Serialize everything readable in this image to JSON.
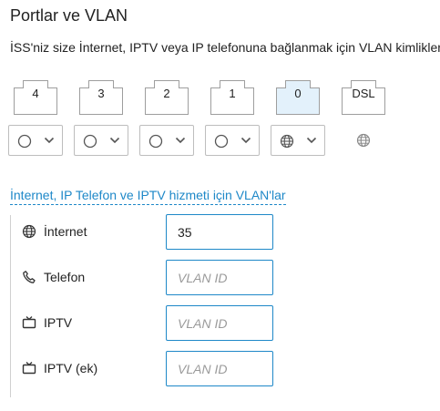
{
  "page": {
    "title": "Portlar ve VLAN",
    "subtitle": "İSS'niz size İnternet, IPTV veya IP telefonuna bağlanmak için VLAN kimlikleri"
  },
  "ports": [
    {
      "label": "4",
      "selected": false
    },
    {
      "label": "3",
      "selected": false
    },
    {
      "label": "2",
      "selected": false
    },
    {
      "label": "1",
      "selected": false
    },
    {
      "label": "0",
      "selected": true
    },
    {
      "label": "DSL",
      "selected": false
    }
  ],
  "port_selects": [
    {
      "icon": "circle-icon"
    },
    {
      "icon": "circle-icon"
    },
    {
      "icon": "circle-icon"
    },
    {
      "icon": "circle-icon"
    },
    {
      "icon": "globe-icon"
    }
  ],
  "dsl_icon": "globe-icon",
  "vlan_section": {
    "title": "İnternet, IP Telefon ve IPTV hizmeti için VLAN'lar",
    "rows": [
      {
        "label": "İnternet",
        "icon": "globe-icon",
        "value": "35",
        "placeholder": "VLAN ID"
      },
      {
        "label": "Telefon",
        "icon": "phone-icon",
        "value": "",
        "placeholder": "VLAN ID"
      },
      {
        "label": "IPTV",
        "icon": "tv-icon",
        "value": "",
        "placeholder": "VLAN ID"
      },
      {
        "label": "IPTV (ek)",
        "icon": "tv-icon",
        "value": "",
        "placeholder": "VLAN ID"
      }
    ]
  },
  "colors": {
    "accent": "#1e88c8",
    "port_border": "#9e9e9e",
    "port_selected_fill": "#e3f1fb"
  }
}
